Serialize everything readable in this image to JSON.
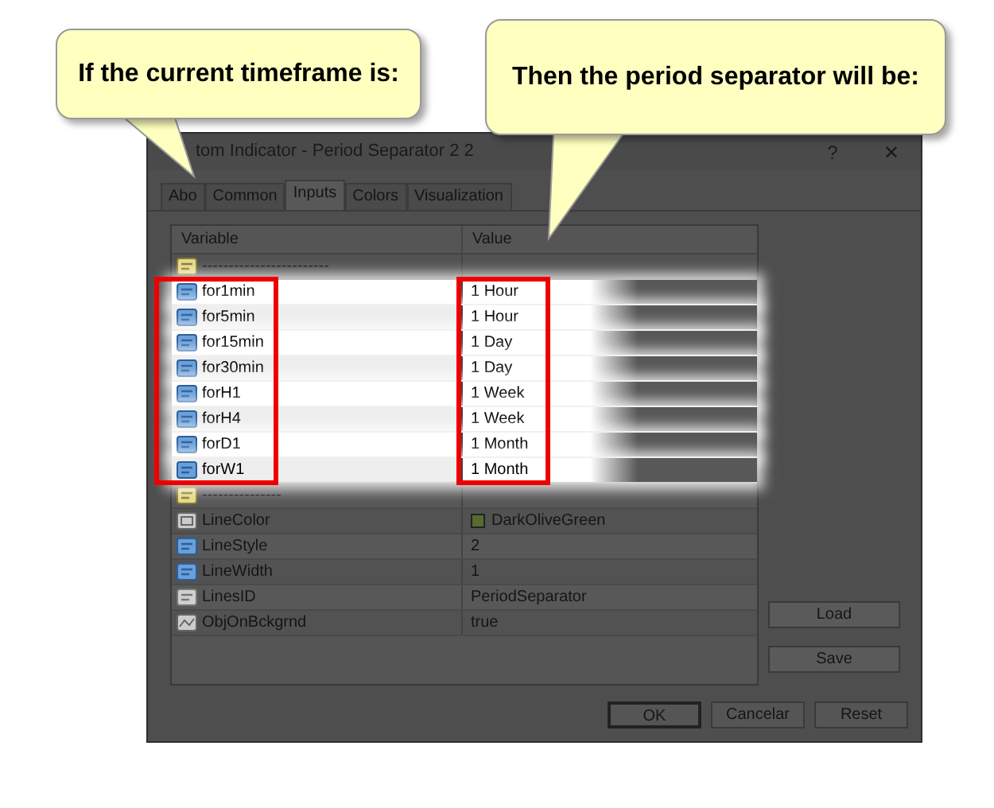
{
  "callouts": [
    {
      "text": "If the current timeframe is:"
    },
    {
      "text": "Then the period separator will be:"
    }
  ],
  "window": {
    "title": "tom Indicator - Period Separator 2 2",
    "help": "?",
    "close": "✕"
  },
  "tabs": [
    {
      "label": "Abo",
      "selected": false
    },
    {
      "label": "Common",
      "selected": false
    },
    {
      "label": "Inputs",
      "selected": true
    },
    {
      "label": "Colors",
      "selected": false
    },
    {
      "label": "Visualization",
      "selected": false
    }
  ],
  "table": {
    "columns": [
      "Variable",
      "Value"
    ],
    "rows": [
      {
        "kind": "separator",
        "name": "------------------------",
        "highlighted": false
      },
      {
        "kind": "int",
        "name": "for1min",
        "value": "1 Hour",
        "highlighted": true
      },
      {
        "kind": "int",
        "name": "for5min",
        "value": "1 Hour",
        "highlighted": true
      },
      {
        "kind": "int",
        "name": "for15min",
        "value": "1 Day",
        "highlighted": true
      },
      {
        "kind": "int",
        "name": "for30min",
        "value": "1 Day",
        "highlighted": true
      },
      {
        "kind": "int",
        "name": "forH1",
        "value": "1 Week",
        "highlighted": true
      },
      {
        "kind": "int",
        "name": "forH4",
        "value": "1 Week",
        "highlighted": true
      },
      {
        "kind": "int",
        "name": "forD1",
        "value": "1 Month",
        "highlighted": true
      },
      {
        "kind": "int",
        "name": "forW1",
        "value": "1 Month",
        "highlighted": true
      },
      {
        "kind": "separator",
        "name": "---------------",
        "highlighted": false
      },
      {
        "kind": "color",
        "name": "LineColor",
        "value": "DarkOliveGreen",
        "color": "#556b2f",
        "highlighted": false
      },
      {
        "kind": "int",
        "name": "LineStyle",
        "value": "2",
        "highlighted": false
      },
      {
        "kind": "int",
        "name": "LineWidth",
        "value": "1",
        "highlighted": false
      },
      {
        "kind": "string",
        "name": "LinesID",
        "value": "PeriodSeparator",
        "highlighted": false
      },
      {
        "kind": "bool",
        "name": "ObjOnBckgrnd",
        "value": "true",
        "highlighted": false
      }
    ]
  },
  "side_buttons": [
    "Load",
    "Save"
  ],
  "buttons": [
    {
      "label": "OK",
      "default": true
    },
    {
      "label": "Cancelar",
      "default": false
    },
    {
      "label": "Reset",
      "default": false
    }
  ]
}
